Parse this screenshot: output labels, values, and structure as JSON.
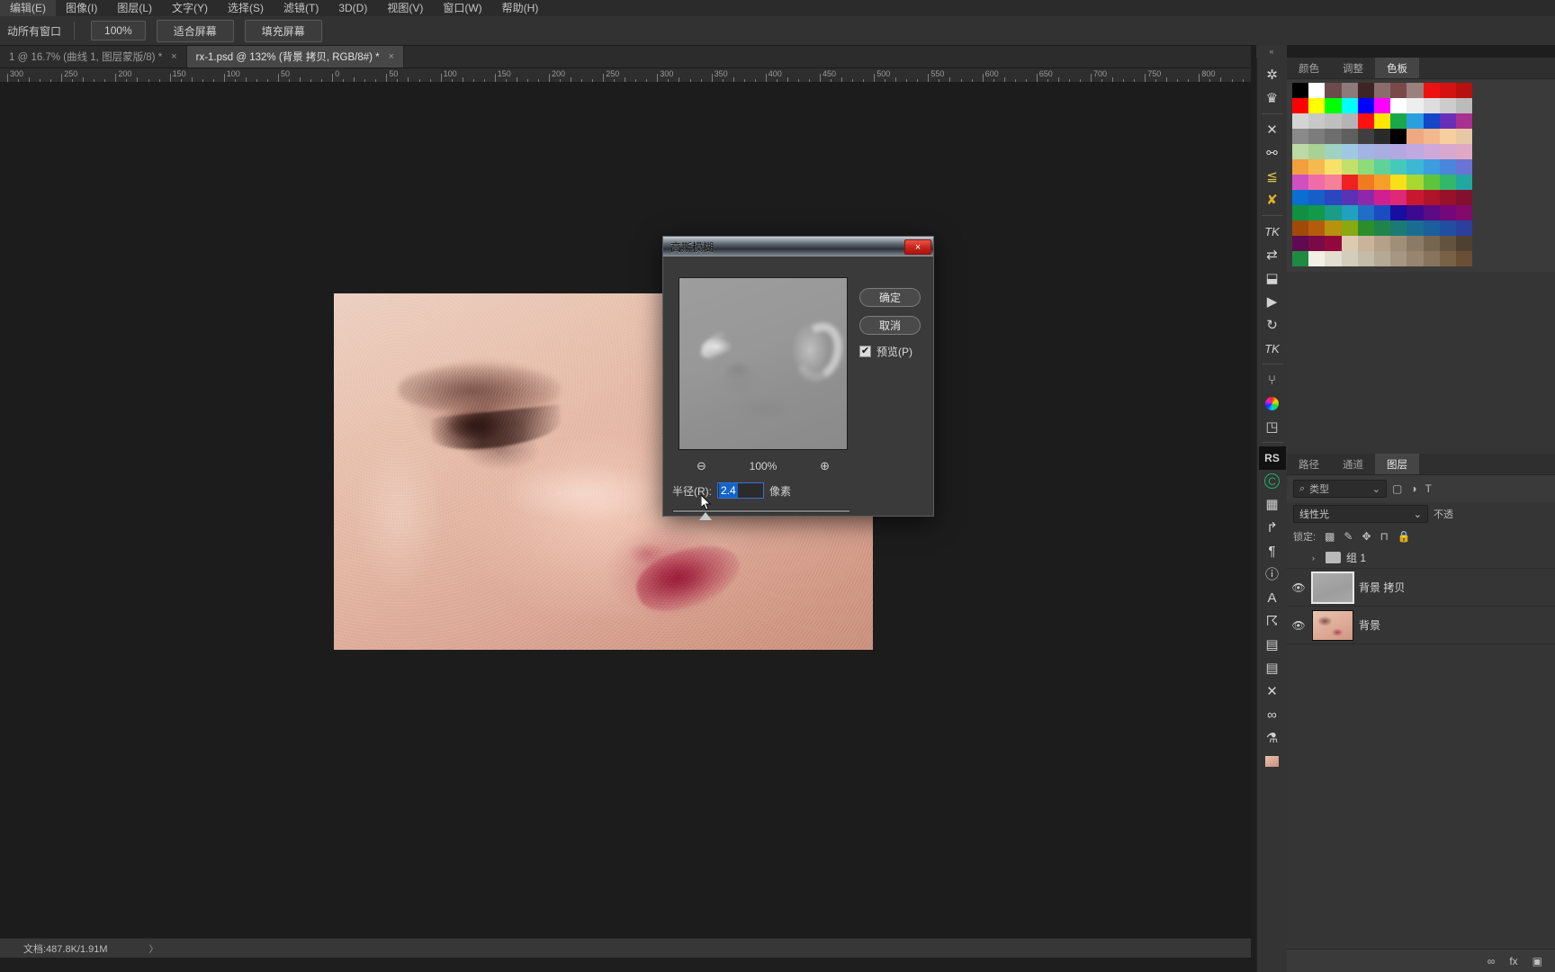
{
  "menubar": {
    "items": [
      {
        "label": "编辑(E)"
      },
      {
        "label": "图像(I)"
      },
      {
        "label": "图层(L)"
      },
      {
        "label": "文字(Y)"
      },
      {
        "label": "选择(S)"
      },
      {
        "label": "滤镜(T)"
      },
      {
        "label": "3D(D)"
      },
      {
        "label": "视图(V)"
      },
      {
        "label": "窗口(W)"
      },
      {
        "label": "帮助(H)"
      }
    ]
  },
  "optionsbar": {
    "move_all_windows_label": "动所有窗口",
    "zoom_value": "100%",
    "fit_screen_label": "适合屏幕",
    "fill_screen_label": "填充屏幕"
  },
  "tabs": [
    {
      "label": "1 @ 16.7% (曲线 1, 图层蒙版/8) *",
      "close": "×",
      "active": false
    },
    {
      "label": "rx-1.psd @ 132% (背景 拷贝, RGB/8#) *",
      "close": "×",
      "active": true
    }
  ],
  "ruler": {
    "unit": "px",
    "labels": [
      "300",
      "250",
      "200",
      "150",
      "100",
      "50",
      "0",
      "50",
      "100",
      "150",
      "200",
      "250",
      "300",
      "350",
      "400",
      "450",
      "500",
      "550",
      "600",
      "650",
      "700",
      "750",
      "800"
    ]
  },
  "statusbar": {
    "doc_text": "文档:487.8K/1.91M",
    "arrow": "〉"
  },
  "dialog": {
    "title": "高斯模糊",
    "close_label": "×",
    "ok_label": "确定",
    "cancel_label": "取消",
    "preview_label": "预览(P)",
    "preview_checked": true,
    "check_glyph": "✔",
    "zoom_out_icon": "zoom-out-icon",
    "zoom_in_icon": "zoom-in-icon",
    "zoom_percent": "100%",
    "radius_label": "半径(R):",
    "radius_value": "2.4",
    "radius_unit": "像素"
  },
  "right_rail": {
    "collapse_glyph": "«",
    "icons": [
      {
        "name": "compass-icon",
        "glyph": "✲"
      },
      {
        "name": "crown-icon",
        "glyph": "♛"
      },
      {
        "name": "close-x-icon",
        "glyph": "✕"
      },
      {
        "name": "node-icon",
        "glyph": "⚯"
      },
      {
        "name": "stack-icon",
        "glyph": "≦"
      },
      {
        "name": "cross-tools-icon",
        "glyph": "✘"
      },
      {
        "name": "tk-icon",
        "glyph": "TK"
      },
      {
        "name": "sliders-icon",
        "glyph": "⇄"
      },
      {
        "name": "cube-icon",
        "glyph": "⬓"
      },
      {
        "name": "play-icon",
        "glyph": "▶"
      },
      {
        "name": "refresh-icon",
        "glyph": "↻"
      },
      {
        "name": "tk-alt-icon",
        "glyph": "TK"
      },
      {
        "name": "brush-set-icon",
        "glyph": "⑂"
      },
      {
        "name": "color-wheel-icon",
        "glyph": "◉"
      },
      {
        "name": "shapes-icon",
        "glyph": "◳"
      },
      {
        "name": "rs-icon",
        "glyph": "RS"
      },
      {
        "name": "c-circle-icon",
        "glyph": "C"
      },
      {
        "name": "grid-icon",
        "glyph": "▦"
      },
      {
        "name": "rotate-icon",
        "glyph": "↱"
      },
      {
        "name": "paragraph-icon",
        "glyph": "¶"
      },
      {
        "name": "info-icon",
        "glyph": "ⓘ"
      },
      {
        "name": "text-cursor-icon",
        "glyph": "A"
      },
      {
        "name": "stamp-icon",
        "glyph": "☈"
      },
      {
        "name": "document-icon",
        "glyph": "▤"
      },
      {
        "name": "notes-icon",
        "glyph": "▤"
      },
      {
        "name": "cutlery-icon",
        "glyph": "✕"
      },
      {
        "name": "link-icon",
        "glyph": "∞"
      },
      {
        "name": "flask-icon",
        "glyph": "⚗"
      },
      {
        "name": "portrait-icon",
        "glyph": "▣"
      }
    ]
  },
  "panels": {
    "top_tabs": [
      {
        "label": "颜色",
        "active": false
      },
      {
        "label": "调整",
        "active": false
      },
      {
        "label": "色板",
        "active": true
      }
    ],
    "swatch_rows": [
      [
        "#000000",
        "#ffffff",
        "#6b4b4b",
        "#8d7a7a",
        "#3e2424",
        "#8a6c6c",
        "#7a4a4a",
        "#9b8080",
        "#ee1111",
        "#d41212",
        "#b71010"
      ],
      [
        "#ff0000",
        "#ffff00",
        "#00ff00",
        "#00ffff",
        "#0000ff",
        "#ff00ff",
        "#ffffff",
        "#eeeeee",
        "#dddddd",
        "#cccccc",
        "#bbbbbb"
      ],
      [
        "#d4d4d4",
        "#c8c8c8",
        "#bfbfbf",
        "#b4b4b4",
        "#ff1111",
        "#ffe600",
        "#1aa84a",
        "#2a9fe0",
        "#1346c8",
        "#6a2fb8",
        "#a83090"
      ],
      [
        "#8a8a8a",
        "#7c7c7c",
        "#6e6e6e",
        "#5f5f5f",
        "#3f3f3f",
        "#2a2a2a",
        "#000000",
        "#f0a882",
        "#f3b98c",
        "#f7cf9e",
        "#e8c8a4"
      ],
      [
        "#bcd9a6",
        "#a8d194",
        "#9ed2c2",
        "#9fc9e2",
        "#a2b4e4",
        "#a9aee0",
        "#b3a8e2",
        "#c0a8e0",
        "#cfa8da",
        "#d8a8cf",
        "#e0a8c4"
      ],
      [
        "#f0a03c",
        "#f5b950",
        "#f9e06a",
        "#c3e06a",
        "#8ddb7a",
        "#5fd29a",
        "#45c9bd",
        "#3cb8d4",
        "#3c9ede",
        "#4a86dc",
        "#6a74d4"
      ],
      [
        "#d050c0",
        "#f06ca8",
        "#f4809a",
        "#ee2222",
        "#f07a20",
        "#f5a02a",
        "#f7e019",
        "#a8d832",
        "#5ec43c",
        "#32b86a",
        "#20a8a0"
      ],
      [
        "#0a6fd0",
        "#1560c8",
        "#2a46c0",
        "#5a32b4",
        "#8e28aa",
        "#d02090",
        "#e02878",
        "#c81830",
        "#b01428",
        "#98102a",
        "#82102e"
      ],
      [
        "#109040",
        "#12994a",
        "#1a9c86",
        "#22a0c0",
        "#1f6fc4",
        "#1b4cc0",
        "#180ea0",
        "#3c0a90",
        "#5c0a86",
        "#74087a",
        "#820a6c"
      ],
      [
        "#a04a08",
        "#b45c0c",
        "#b8920e",
        "#8aa810",
        "#2a8e2a",
        "#20844a",
        "#1c7a74",
        "#186e90",
        "#1b5f9e",
        "#204ea0",
        "#2a3f9e"
      ],
      [
        "#600a50",
        "#7a0a46",
        "#92083c",
        "#ddcbb0",
        "#c9b49b",
        "#b5a189",
        "#a08f78",
        "#8b7a66",
        "#77664f",
        "#63523e",
        "#4f412f"
      ],
      [
        "#1f8a42",
        "#f2efe4",
        "#e2ded0",
        "#d3cdbc",
        "#c4bba8",
        "#b5a995",
        "#a69782",
        "#97856f",
        "#88735c",
        "#796148",
        "#6a4f35"
      ]
    ],
    "layers": {
      "tabs": [
        {
          "label": "路径",
          "active": false
        },
        {
          "label": "通道",
          "active": false
        },
        {
          "label": "图层",
          "active": true
        }
      ],
      "filter_placeholder": "类型",
      "blend_mode": "线性光",
      "opacity_label": "不透",
      "lock_label": "锁定:",
      "rows": [
        {
          "name": "组 1",
          "type": "group",
          "eye": "",
          "thumb": "none",
          "selected": false
        },
        {
          "name": "背景 拷贝",
          "type": "layer",
          "eye": "👁",
          "thumb": "grey",
          "selected": true
        },
        {
          "name": "背景",
          "type": "layer",
          "eye": "👁",
          "thumb": "face",
          "selected": false
        }
      ],
      "footer_icons": [
        "link-icon",
        "fx-icon",
        "mask-icon"
      ]
    }
  },
  "colors": {
    "app_bg": "#1e1e1e",
    "panel_bg": "#353535",
    "accent_selection": "#1264c8",
    "dialog_close_red": "#c9241a"
  }
}
